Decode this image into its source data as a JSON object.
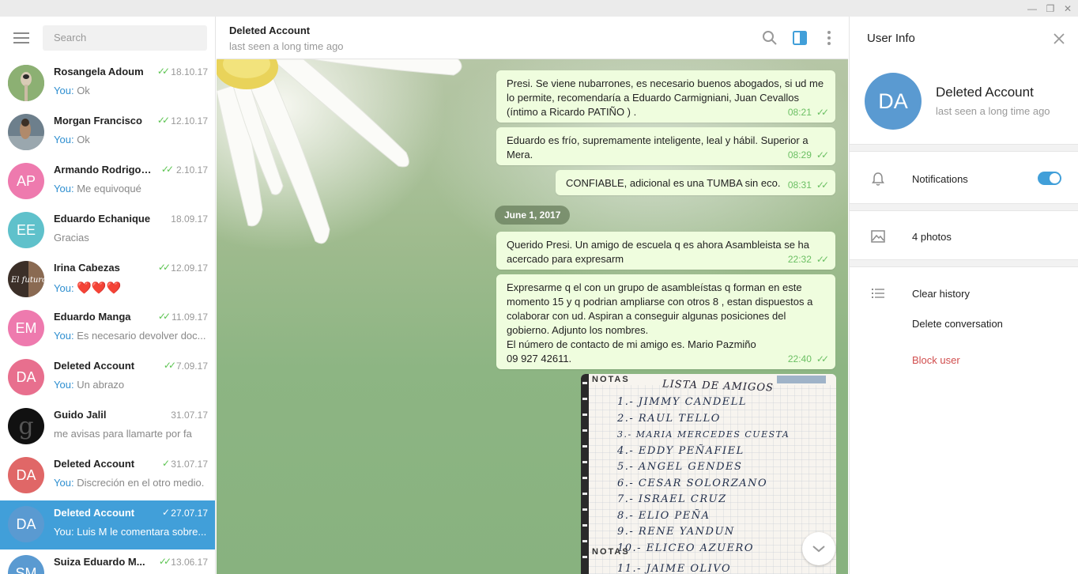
{
  "window": {
    "min": "—",
    "restore": "❐",
    "close": "✕"
  },
  "search": {
    "placeholder": "Search"
  },
  "chats": [
    {
      "name": "Rosangela Adoum",
      "date": "18.10.17",
      "you": "You:",
      "preview": "Ok",
      "color": "#6c8f5a",
      "initials": ""
    },
    {
      "name": "Morgan Francisco",
      "date": "12.10.17",
      "you": "You:",
      "preview": "Ok",
      "color": "#5b6b78",
      "initials": ""
    },
    {
      "name": "Armando Rodrigo ...",
      "date": "2.10.17",
      "you": "You:",
      "preview": "Me equivoqué",
      "color": "#ee7aae",
      "initials": "AP"
    },
    {
      "name": "Eduardo Echanique",
      "date": "18.09.17",
      "you": "",
      "preview": "Gracias",
      "color": "#5fc1cb",
      "initials": "EE"
    },
    {
      "name": "Irina Cabezas",
      "date": "12.09.17",
      "you": "You:",
      "preview": "❤️❤️❤️",
      "color": "#3b2f28",
      "initials": ""
    },
    {
      "name": "Eduardo Manga",
      "date": "11.09.17",
      "you": "You:",
      "preview": "Es necesario devolver doc...",
      "color": "#ee7aae",
      "initials": "EM"
    },
    {
      "name": "Deleted Account",
      "date": "7.09.17",
      "you": "You:",
      "preview": "Un abrazo",
      "color": "#e86f8e",
      "initials": "DA"
    },
    {
      "name": "Guido Jalil",
      "date": "31.07.17",
      "you": "",
      "preview": "me avisas para llamarte por fa",
      "color": "#111111",
      "initials": "g"
    },
    {
      "name": "Deleted Account",
      "date": "31.07.17",
      "you": "You:",
      "preview": "Discreción en el otro medio.",
      "color": "#e06767",
      "initials": "DA"
    },
    {
      "name": "Deleted Account",
      "date": "27.07.17",
      "you": "You:",
      "preview": "Luis M le comentara sobre...",
      "color": "#5a9ad1",
      "initials": "DA"
    },
    {
      "name": "Suiza Eduardo M...",
      "date": "13.06.17",
      "you": "",
      "preview": "",
      "color": "#5a9ad1",
      "initials": "SM"
    }
  ],
  "header": {
    "name": "Deleted Account",
    "status": "last seen a long time ago"
  },
  "messages": [
    {
      "text": "Presi. Se viene nubarrones, es necesario buenos abogados, si ud me lo permite, recomendaría a Eduardo Carmigniani, Juan Cevallos (íntimo a Ricardo PATIÑO ) .",
      "time": "08:21"
    },
    {
      "text": "Eduardo es frío, supremamente inteligente, leal y hábil. Superior a Mera.",
      "time": "08:29"
    },
    {
      "text": "CONFIABLE, adicional es una TUMBA sin eco.",
      "time": "08:31"
    },
    {
      "text": "Querido Presi. Un amigo de escuela q es ahora Asambleista se ha acercado para expresarm",
      "time": "22:32"
    },
    {
      "text": "Expresarme q el con un grupo de asambleístas q forman en este momento 15 y q podrian ampliarse con otros 8 , estan dispuestos a colaborar con ud. Aspiran a conseguir algunas posiciones del gobierno. Adjunto los nombres.\nEl número de contacto de mi amigo es. Mario Pazmiño\n09 927 42611.",
      "time": "22:40"
    }
  ],
  "date_pill": "June 1, 2017",
  "photo": {
    "header": "NOTAS",
    "title": "LISTA DE AMIGOS",
    "lines": [
      "1.- JIMMY CANDELL",
      "2.- RAUL TELLO",
      "3.- MARIA MERCEDES CUESTA",
      "4.- EDDY PEÑAFIEL",
      "5.- ANGEL GENDES",
      "6.- CESAR SOLORZANO",
      "7.- ISRAEL CRUZ",
      "8.- ELIO PEÑA",
      "9.- RENE YANDUN",
      "10.- ELICEO AZUERO",
      "11.- JAIME OLIVO"
    ],
    "footer": "NOTAS"
  },
  "user_info": {
    "title": "User Info",
    "initials": "DA",
    "name": "Deleted Account",
    "status": "last seen a long time ago",
    "notifications": "Notifications",
    "notifications_on": true,
    "photos": "4 photos",
    "clear_history": "Clear history",
    "delete_conversation": "Delete conversation",
    "block_user": "Block user"
  },
  "colors": {
    "accent": "#419fd9",
    "check": "#5dc452",
    "danger": "#d14e4e",
    "bubble": "#effdde"
  }
}
